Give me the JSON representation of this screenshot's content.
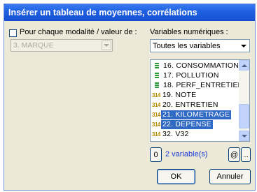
{
  "dialog": {
    "title": "Insérer un tableau de moyennes, corrélations"
  },
  "left": {
    "checkbox_label": "Pour chaque modalité / valeur de :",
    "checked": false,
    "combo_value": "3. MARQUE"
  },
  "right": {
    "label": "Variables numériques :",
    "combo_value": "Toutes les variables",
    "list_items": [
      {
        "label": "16. CONSOMMATION",
        "icon": "column-icon",
        "selected": false
      },
      {
        "label": "17. POLLUTION",
        "icon": "column-icon",
        "selected": false
      },
      {
        "label": "18. PERF_ENTRETIEN",
        "icon": "column-icon",
        "selected": false
      },
      {
        "label": "19. NOTE",
        "icon": "numeric-icon",
        "selected": false
      },
      {
        "label": "20. ENTRETIEN",
        "icon": "numeric-icon",
        "selected": false
      },
      {
        "label": "21. KILOMETRAGE",
        "icon": "numeric-icon",
        "selected": true
      },
      {
        "label": "22. DEPENSE",
        "icon": "numeric-icon",
        "selected": true
      },
      {
        "label": "32. V32",
        "icon": "numeric-icon",
        "selected": false
      }
    ],
    "numeric_icon_text": "314",
    "zero_button": "0",
    "selection_count": "2 variable(s)",
    "at_button": "@",
    "more_button": "...",
    "ok_button": "OK",
    "cancel_button": "Annuler"
  },
  "colors": {
    "title_bar": "#1e5fe0",
    "dialog_bg": "#ece9d8",
    "selection": "#316ac5",
    "count_text": "#1a3ad6"
  }
}
